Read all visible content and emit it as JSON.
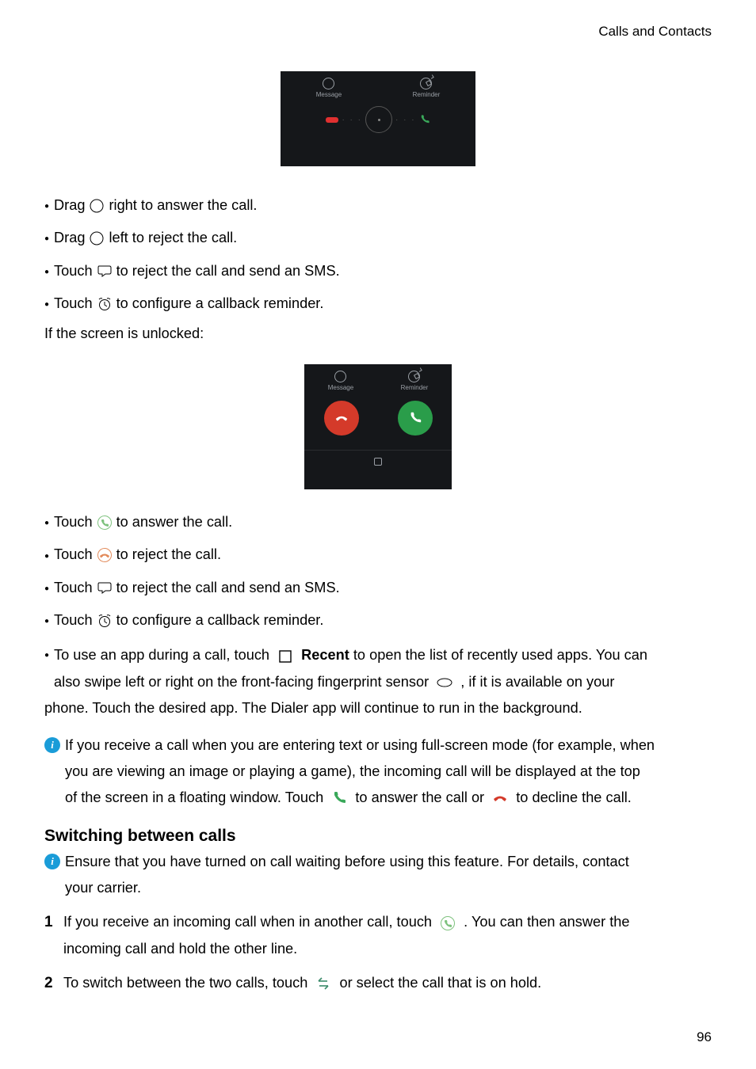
{
  "header": {
    "section_title": "Calls and Contacts"
  },
  "screenshot1": {
    "message_label": "Message",
    "reminder_label": "Reminder"
  },
  "bullets_locked": [
    {
      "pre": "Drag ",
      "post": " right to answer the call.",
      "icon": "circle"
    },
    {
      "pre": "Drag ",
      "post": " left to reject the call.",
      "icon": "circle"
    },
    {
      "pre": "Touch ",
      "post": " to reject the call and send an SMS.",
      "icon": "message"
    },
    {
      "pre": "Touch ",
      "post": " to configure a callback reminder.",
      "icon": "reminder"
    }
  ],
  "unlocked_intro": "If the screen is unlocked:",
  "screenshot2": {
    "message_label": "Message",
    "reminder_label": "Reminder"
  },
  "bullets_unlocked": [
    {
      "pre": "Touch ",
      "post": " to answer the call.",
      "icon": "answer-small"
    },
    {
      "pre": "Touch ",
      "post": " to reject the call.",
      "icon": "reject-small"
    },
    {
      "pre": "Touch ",
      "post": " to reject the call and send an SMS.",
      "icon": "message"
    },
    {
      "pre": "Touch ",
      "post": " to configure a callback reminder.",
      "icon": "reminder"
    }
  ],
  "recent_bullet": {
    "pre": "To use an app during a call, touch ",
    "recent_label": "Recent",
    "mid1": " to open the list of recently used apps. You can",
    "line2a": "also swipe left or right on the front-facing fingerprint sensor ",
    "line2b": ", if it is available on your",
    "line3": "phone. Touch the desired app. The Dialer app will continue to run in the background."
  },
  "info_floating": {
    "line1": "If you receive a call when you are entering text or using full-screen mode (for example, when",
    "line2": "you are viewing an image or playing a game), the incoming call will be displayed at the top",
    "line3a": "of the screen in a floating window. Touch ",
    "line3b": " to answer the call or ",
    "line3c": " to decline the call."
  },
  "section_heading": "Switching between calls",
  "info_waiting": {
    "line1": "Ensure that you have turned on call waiting before using this feature. For details, contact",
    "line2": "your carrier."
  },
  "step1": {
    "num": "1",
    "a": "If you receive an incoming call when in another call, touch ",
    "b": " . You can then answer the",
    "c": "incoming call and hold the other line."
  },
  "step2": {
    "num": "2",
    "a": "To switch between the two calls, touch ",
    "b": " or select the call that is on hold."
  },
  "page_number": "96"
}
